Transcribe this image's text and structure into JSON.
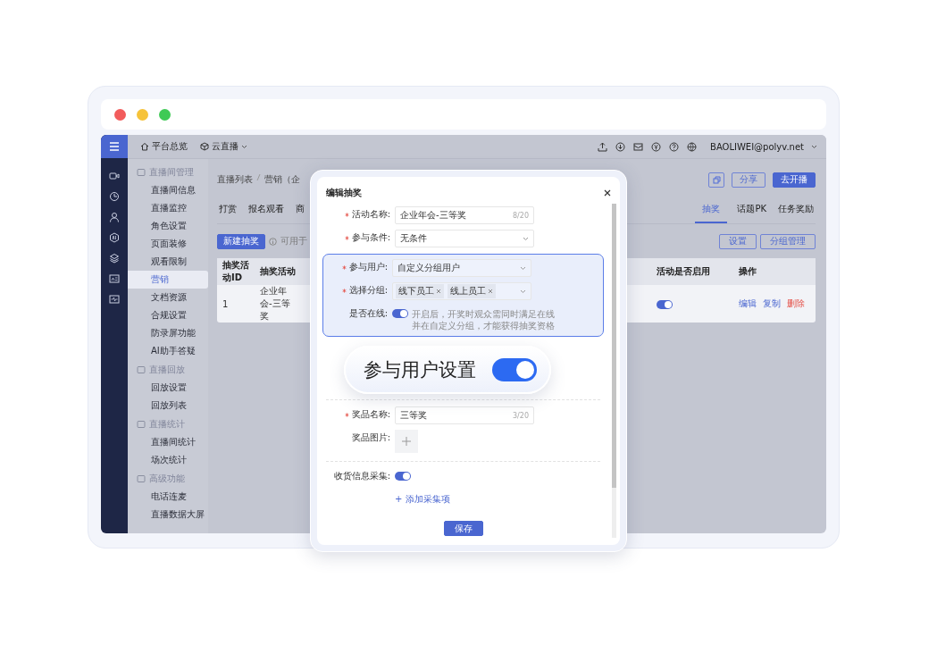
{
  "topbar": {
    "home": "平台总览",
    "product": "云直播",
    "account": "BAOLIWEI@polyv.net"
  },
  "sidebar": {
    "groups": [
      {
        "title": "直播间管理",
        "items": [
          {
            "label": "直播间信息",
            "selected": false
          },
          {
            "label": "直播监控",
            "selected": false
          },
          {
            "label": "角色设置",
            "selected": false
          },
          {
            "label": "页面装修",
            "selected": false
          },
          {
            "label": "观看限制",
            "selected": false
          },
          {
            "label": "营销",
            "selected": true
          },
          {
            "label": "文档资源",
            "selected": false
          },
          {
            "label": "合规设置",
            "selected": false
          },
          {
            "label": "防录屏功能",
            "selected": false
          },
          {
            "label": "AI助手答疑",
            "selected": false
          }
        ]
      },
      {
        "title": "直播回放",
        "items": [
          {
            "label": "回放设置",
            "selected": false
          },
          {
            "label": "回放列表",
            "selected": false
          }
        ]
      },
      {
        "title": "直播统计",
        "items": [
          {
            "label": "直播间统计",
            "selected": false
          },
          {
            "label": "场次统计",
            "selected": false
          }
        ]
      },
      {
        "title": "高级功能",
        "items": [
          {
            "label": "电话连麦",
            "selected": false
          },
          {
            "label": "直播数据大屏",
            "selected": false
          }
        ]
      }
    ]
  },
  "breadcrumb": [
    "直播列表",
    "营销（企"
  ],
  "header_buttons": [
    {
      "label": "分享",
      "kind": "outline"
    },
    {
      "label": "去开播",
      "kind": "primary"
    }
  ],
  "tabs_left": [
    {
      "label": "打赏",
      "selected": false
    },
    {
      "label": "报名观看",
      "selected": false
    },
    {
      "label": "商",
      "selected": false
    }
  ],
  "tabs_right": [
    {
      "label": "抽奖",
      "selected": true
    },
    {
      "label": "话题PK",
      "selected": false
    },
    {
      "label": "任务奖励",
      "selected": false
    }
  ],
  "new_button": "新建抽奖",
  "hint": "可用于",
  "side_buttons": [
    "设置",
    "分组管理"
  ],
  "table": {
    "columns_left": [
      "抽奖活动ID",
      "抽奖活动"
    ],
    "columns_right": [
      "活动是否启用",
      "操作"
    ],
    "rows": [
      {
        "id": "1",
        "name": "企业年会-三等奖",
        "enabled": true,
        "actions": [
          {
            "label": "编辑",
            "kind": "normal"
          },
          {
            "label": "复制",
            "kind": "normal"
          },
          {
            "label": "删除",
            "kind": "danger"
          }
        ]
      }
    ]
  },
  "modal": {
    "title": "编辑抽奖",
    "sections": [
      {
        "kind": "plain",
        "fields": [
          {
            "label": "活动名称:",
            "required": true,
            "kind": "input",
            "value": "企业年会-三等奖",
            "counter": "8/20"
          },
          {
            "label": "参与条件:",
            "required": true,
            "kind": "select",
            "value": "无条件"
          }
        ]
      },
      {
        "kind": "highlight",
        "fields": [
          {
            "label": "参与用户:",
            "required": true,
            "kind": "select",
            "value": "自定义分组用户"
          },
          {
            "label": "选择分组:",
            "required": true,
            "kind": "tags",
            "tags": [
              "线下员工",
              "线上员工"
            ]
          },
          {
            "label": "是否在线:",
            "required": false,
            "kind": "switch",
            "on": true,
            "hint": "开启后，开奖时观众需同时满足在线并在自定义分组，才能获得抽奖资格"
          }
        ]
      },
      {
        "kind": "divided",
        "fields": [
          {
            "label": "奖品名称:",
            "required": true,
            "kind": "input",
            "value": "三等奖",
            "counter": "3/20"
          },
          {
            "label": "奖品图片:",
            "required": false,
            "kind": "upload"
          }
        ]
      },
      {
        "kind": "divided",
        "fields": [
          {
            "label": "收货信息采集:",
            "required": false,
            "kind": "switch",
            "on": true
          },
          {
            "required": false,
            "kind": "link",
            "value": "+ 添加采集项"
          }
        ]
      }
    ],
    "save": "保存"
  },
  "callout": {
    "label": "参与用户设置",
    "on": true
  }
}
